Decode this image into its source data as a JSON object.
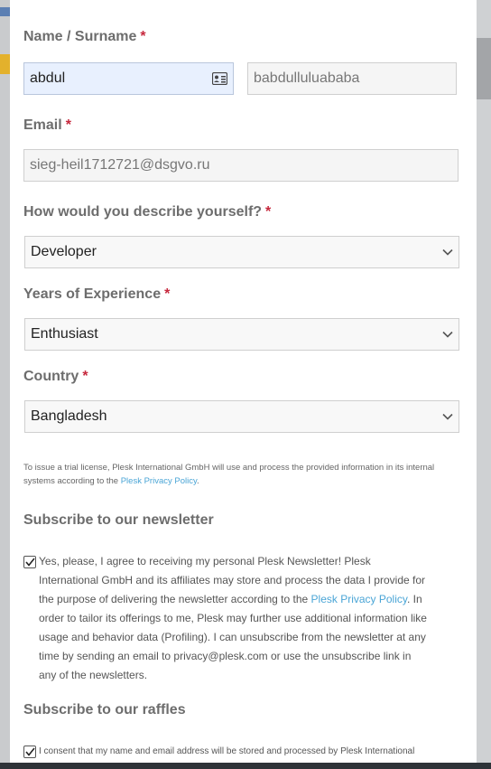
{
  "form": {
    "name": {
      "label": "Name / Surname",
      "required_mark": "*",
      "first_value": "abdul",
      "last_value": "babdulluluababa"
    },
    "email": {
      "label": "Email",
      "required_mark": "*",
      "value": "sieg-heil1712721@dsgvo.ru"
    },
    "describe": {
      "label": "How would you describe yourself?",
      "required_mark": "*",
      "selected": "Developer"
    },
    "experience": {
      "label": "Years of Experience",
      "required_mark": "*",
      "selected": "Enthusiast"
    },
    "country": {
      "label": "Country",
      "required_mark": "*",
      "selected": "Bangladesh"
    },
    "notice": {
      "text": "To issue a trial license, Plesk International GmbH will use and process the provided information in its internal systems according to the ",
      "link": "Plesk Privacy Policy",
      "suffix": "."
    }
  },
  "newsletter": {
    "title": "Subscribe to our newsletter",
    "checked": true,
    "text_before": "Yes, please, I agree to receiving my personal Plesk Newsletter! Plesk International GmbH and its affiliates may store and process the data I provide for the purpose of delivering the newsletter according to the ",
    "link": "Plesk Privacy Policy",
    "text_after": ". In order to tailor its offerings to me, Plesk may further use additional information like usage and behavior data (Profiling). I can unsubscribe from the newsletter at any time by sending an email to privacy@plesk.com or use the unsubscribe link in any of the newsletters."
  },
  "raffles": {
    "title": "Subscribe to our raffles",
    "checked": true,
    "text": "I consent that my name and email address will be stored and processed by Plesk International"
  },
  "colors": {
    "required": "#c6283d",
    "link": "#4aa5d6",
    "autofill": "#e8f0fe"
  },
  "icons": [
    "contact-card-icon",
    "chevron-down-icon",
    "checkmark-icon"
  ]
}
